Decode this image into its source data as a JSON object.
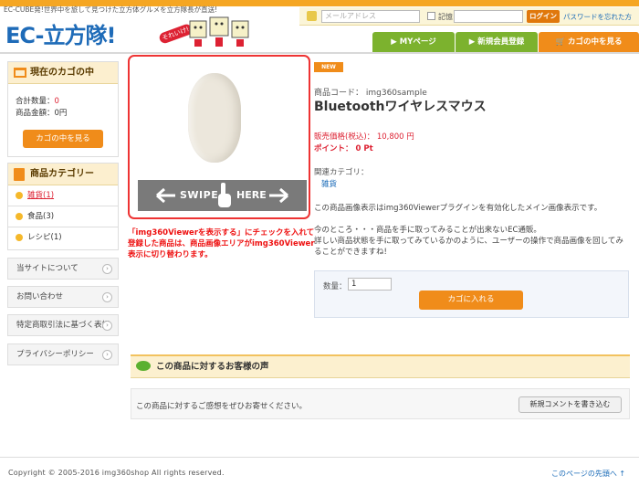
{
  "header": {
    "tagline": "EC-CUBE発!世界中を旅して見つけた立方体グルメを立方隊長が直送!",
    "logo_text": "EC-立方隊!",
    "logo_badge": "それいけ!",
    "email_placeholder": "メールアドレス",
    "remember_label": "記憶",
    "login_label": "ログイン",
    "forgot_label": "パスワードを忘れた方"
  },
  "nav": {
    "mypage": "MYページ",
    "register": "新規会員登録",
    "cart": "カゴの中を見る"
  },
  "sidebar": {
    "cart_title": "現在のカゴの中",
    "total_qty_label": "合計数量：",
    "total_qty_value": "0",
    "total_price_label": "商品金額：",
    "total_price_value": "0円",
    "view_cart": "カゴの中を見る",
    "category_title": "商品カテゴリー",
    "categories": [
      "雑貨(1)",
      "食品(3)",
      "レシピ(1)"
    ],
    "links": [
      "当サイトについて",
      "お問い合わせ",
      "特定商取引法に基づく表記",
      "プライバシーポリシー"
    ]
  },
  "product": {
    "swipe_left": "SWIPE",
    "swipe_right": "HERE",
    "note": "「img360Viewerを表示する」にチェックを入れて登録した商品は、商品画像エリアがimg360Viewer表示に切り替わります。",
    "new_badge": "NEW",
    "code": "商品コード： img360sample",
    "name": "Bluetoothワイヤレスマウス",
    "price": "販売価格(税込)： 10,800 円",
    "point": "ポイント： 0 Pt",
    "related_label": "関連カテゴリ：",
    "related_value": "雑貨",
    "desc1": "この商品画像表示はimg360Viewerプラグインを有効化したメイン画像表示です。",
    "desc2": "今のところ・・・商品を手に取ってみることが出来ないEC通販。",
    "desc3": "詳しい商品状態を手に取ってみているかのように、ユーザーの操作で商品画像を回してみることができますね!",
    "qty_label": "数量：",
    "qty_value": "1",
    "add_to_cart": "カゴに入れる"
  },
  "reviews": {
    "title": "この商品に対するお客様の声",
    "empty_text": "この商品に対するご感想をぜひお寄せください。",
    "new_comment": "新規コメントを書き込む"
  },
  "footer": {
    "copyright": "Copyright © 2005-2016 img360shop All rights reserved.",
    "page_top": "このページの先頭へ"
  }
}
